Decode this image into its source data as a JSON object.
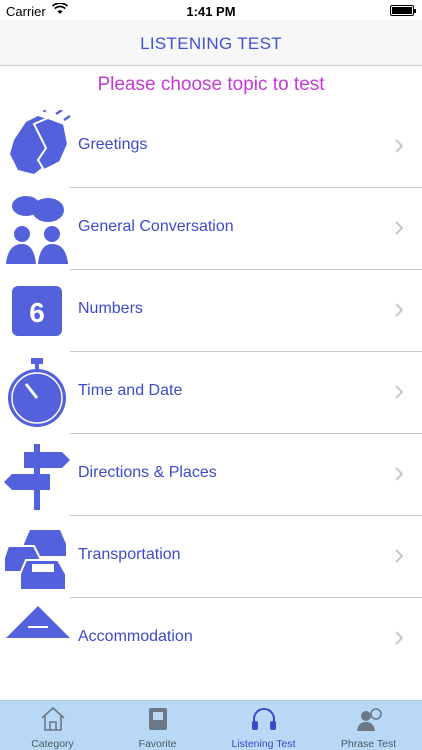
{
  "status_bar": {
    "carrier": "Carrier",
    "time": "1:41 PM"
  },
  "nav": {
    "title": "LISTENING TEST"
  },
  "subtitle": "Please choose topic to test",
  "topics": [
    {
      "label": "Greetings",
      "icon": "clapping-hands-icon"
    },
    {
      "label": "General Conversation",
      "icon": "conversation-people-icon"
    },
    {
      "label": "Numbers",
      "icon": "number-six-icon",
      "icon_text": "6"
    },
    {
      "label": "Time and Date",
      "icon": "stopwatch-icon"
    },
    {
      "label": "Directions & Places",
      "icon": "signpost-icon"
    },
    {
      "label": "Transportation",
      "icon": "cars-icon"
    },
    {
      "label": "Accommodation",
      "icon": "house-roof-icon"
    }
  ],
  "tabs": [
    {
      "label": "Category",
      "icon": "home-icon"
    },
    {
      "label": "Favorite",
      "icon": "book-icon"
    },
    {
      "label": "Listening Test",
      "icon": "headphones-icon",
      "active": true
    },
    {
      "label": "Phrase Test",
      "icon": "person-speech-icon"
    }
  ],
  "colors": {
    "accent": "#3d4bc8",
    "icon": "#5461dc",
    "subtitle": "#c43bd4",
    "tab_bar": "#b9d8f5"
  }
}
